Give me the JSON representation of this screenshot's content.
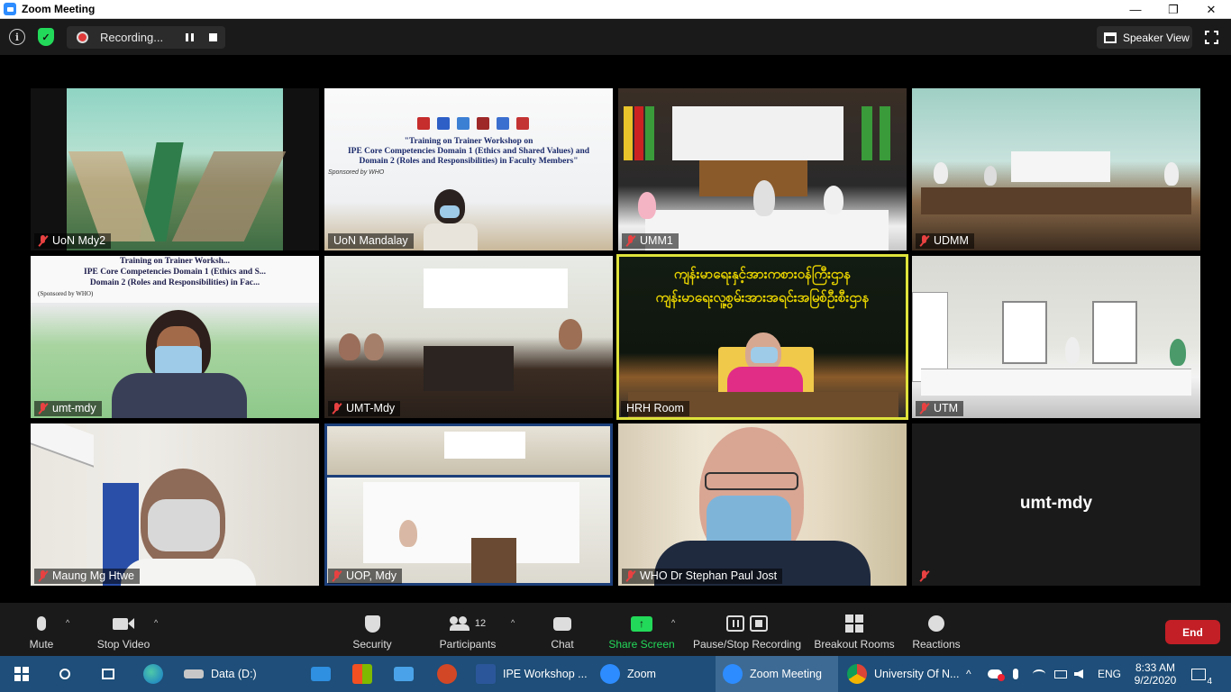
{
  "window": {
    "title": "Zoom Meeting",
    "minimize": "—",
    "restore": "❐",
    "close": "✕"
  },
  "topbar": {
    "info_glyph": "i",
    "recording_label": "Recording...",
    "speaker_view_label": "Speaker View"
  },
  "tiles": [
    {
      "name": "UoN Mdy2",
      "scene": "classroom-green"
    },
    {
      "name": "UoN Mandalay",
      "scene": "banner-presenter",
      "banner_title": "\"Training on Trainer Workshop on",
      "banner_l2": "IPE Core Competencies Domain 1 (Ethics and Shared Values) and",
      "banner_l3": "Domain 2 (Roles and Responsibilities) in Faculty Members\"",
      "banner_sponsor": "Sponsored by WHO"
    },
    {
      "name": "UMM1",
      "scene": "stage-flags"
    },
    {
      "name": "UDMM",
      "scene": "conference-room"
    },
    {
      "name": "umt-mdy",
      "scene": "banner-woman",
      "banner_l1": "Training on Trainer Worksh...",
      "banner_l2": "IPE Core Competencies Domain 1 (Ethics and S...",
      "banner_l3": "Domain 2 (Roles and Responsibilities) in Fac...",
      "banner_sponsor": "(Sponsored by WHO)"
    },
    {
      "name": "UMT-Mdy",
      "scene": "meeting-table"
    },
    {
      "name": "HRH Room",
      "scene": "myanmar-banner",
      "active": true,
      "banner_l1": "ကျန်းမာရေးနှင့်အားကစားဝန်ကြီးဌာန",
      "banner_l2": "ကျန်းမာရေးလူ့စွမ်းအားအရင်းအမြစ်ဦးစီးဌာန"
    },
    {
      "name": "UTM",
      "scene": "hall-windows"
    },
    {
      "name": "Maung Mg Htwe",
      "scene": "man-mask"
    },
    {
      "name": "UOP, Mdy",
      "scene": "banner-split"
    },
    {
      "name": "WHO Dr Stephan Paul Jost",
      "scene": "who-speaker"
    },
    {
      "name": "umt-mdy",
      "scene": "video-off",
      "placeholder_name": "umt-mdy"
    }
  ],
  "toolbar": {
    "mute": "Mute",
    "stop_video": "Stop Video",
    "security": "Security",
    "participants": "Participants",
    "participants_count": "12",
    "chat": "Chat",
    "share_screen": "Share Screen",
    "pause_stop_recording": "Pause/Stop Recording",
    "breakout_rooms": "Breakout Rooms",
    "reactions": "Reactions",
    "end": "End",
    "caret": "^"
  },
  "taskbar": {
    "drive": "Data (D:)",
    "word_doc": "IPE Workshop ...",
    "zoom": "Zoom",
    "zoom_meeting": "Zoom Meeting",
    "chrome": "University Of N...",
    "lang": "ENG",
    "time": "8:33 AM",
    "date": "9/2/2020",
    "notif_count": "4",
    "chevron": "^"
  },
  "colors": {
    "accent_green": "#23d959",
    "end_red": "#c21f26",
    "active_border": "#dfe33b",
    "taskbar": "#1e4e79"
  }
}
